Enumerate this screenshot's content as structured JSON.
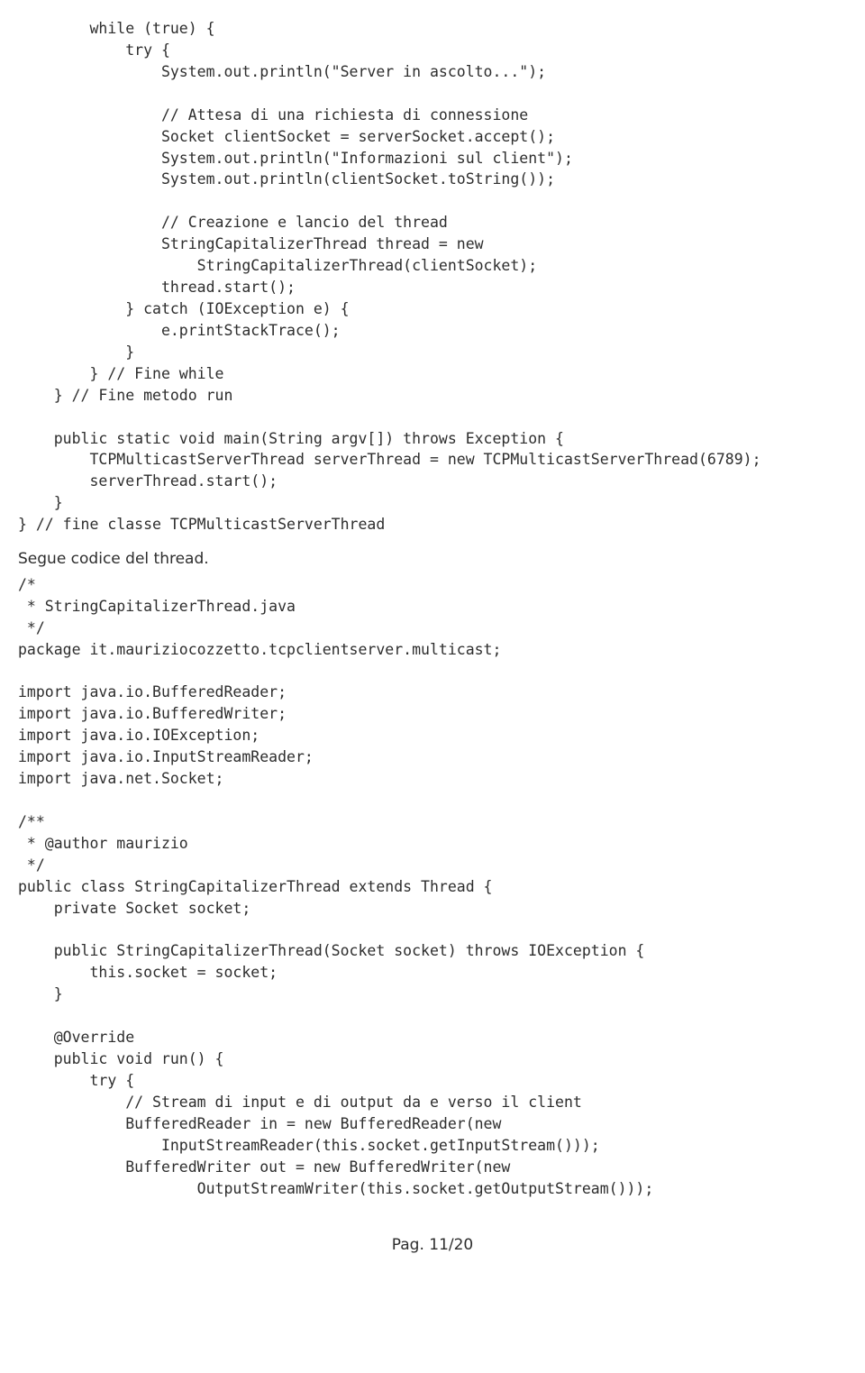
{
  "code_block_1": "        while (true) {\n            try {\n                System.out.println(\"Server in ascolto...\");\n\n                // Attesa di una richiesta di connessione\n                Socket clientSocket = serverSocket.accept();\n                System.out.println(\"Informazioni sul client\");\n                System.out.println(clientSocket.toString());\n\n                // Creazione e lancio del thread\n                StringCapitalizerThread thread = new\n                    StringCapitalizerThread(clientSocket);\n                thread.start();\n            } catch (IOException e) {\n                e.printStackTrace();\n            }\n        } // Fine while\n    } // Fine metodo run\n\n    public static void main(String argv[]) throws Exception {\n        TCPMulticastServerThread serverThread = new TCPMulticastServerThread(6789);\n        serverThread.start();\n    }\n} // fine classe TCPMulticastServerThread",
  "prose_1": "Segue codice del thread.",
  "code_block_2": "/*\n * StringCapitalizerThread.java\n */\npackage it.mauriziocozzetto.tcpclientserver.multicast;\n\nimport java.io.BufferedReader;\nimport java.io.BufferedWriter;\nimport java.io.IOException;\nimport java.io.InputStreamReader;\nimport java.net.Socket;\n\n/**\n * @author maurizio\n */\npublic class StringCapitalizerThread extends Thread {\n    private Socket socket;\n\n    public StringCapitalizerThread(Socket socket) throws IOException {\n        this.socket = socket;\n    }\n\n    @Override\n    public void run() {\n        try {\n            // Stream di input e di output da e verso il client\n            BufferedReader in = new BufferedReader(new\n                InputStreamReader(this.socket.getInputStream()));\n            BufferedWriter out = new BufferedWriter(new\n                    OutputStreamWriter(this.socket.getOutputStream()));",
  "footer": "Pag. 11/20"
}
